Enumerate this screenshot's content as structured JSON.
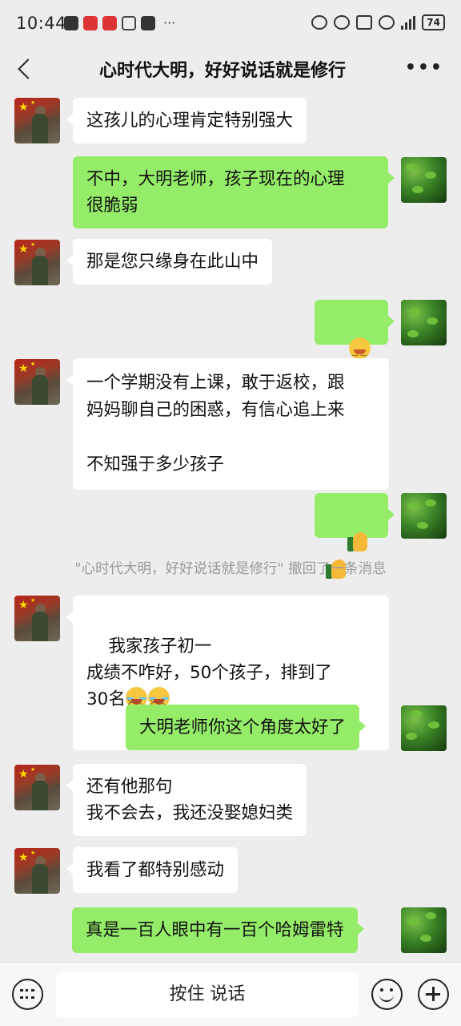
{
  "status_bar": {
    "time": "10:44",
    "network": "4G",
    "battery": "74"
  },
  "header": {
    "title": "心时代大明，好好说话就是修行"
  },
  "messages": [
    {
      "side": "left",
      "text": "这孩儿的心理肯定特别强大"
    },
    {
      "side": "right",
      "text": "不中，大明老师，孩子现在的心理\n很脆弱"
    },
    {
      "side": "left",
      "text": "那是您只缘身在此山中"
    },
    {
      "side": "right",
      "emoji": [
        "tears-smile-icon",
        "tears-smile-icon"
      ]
    },
    {
      "side": "left",
      "text": "一个学期没有上课，敢于返校，跟\n妈妈聊自己的困惑，有信心追上来\n\n不知强于多少孩子"
    },
    {
      "side": "right",
      "emoji": [
        "thumbs-up-icon",
        "thumbs-up-icon"
      ]
    },
    {
      "side": "left",
      "text": "我家孩子初一\n成绩不咋好，50个孩子，排到了\n30名",
      "emoji": [
        "laugh-cry-icon",
        "laugh-cry-icon"
      ]
    },
    {
      "side": "right",
      "text": "大明老师你这个角度太好了"
    },
    {
      "side": "left",
      "text": "还有他那句\n我不会去，我还没娶媳妇类"
    },
    {
      "side": "left",
      "text": "我看了都特别感动"
    },
    {
      "side": "right",
      "text": "真是一百人眼中有一百个哈姆雷特"
    }
  ],
  "system_notice": "\"心时代大明，好好说话就是修行\" 撤回了一条消息",
  "input_bar": {
    "voice_label": "按住 说话"
  },
  "colors": {
    "background": "#ededed",
    "bubble_self": "#95ec69",
    "bubble_other": "#ffffff"
  }
}
